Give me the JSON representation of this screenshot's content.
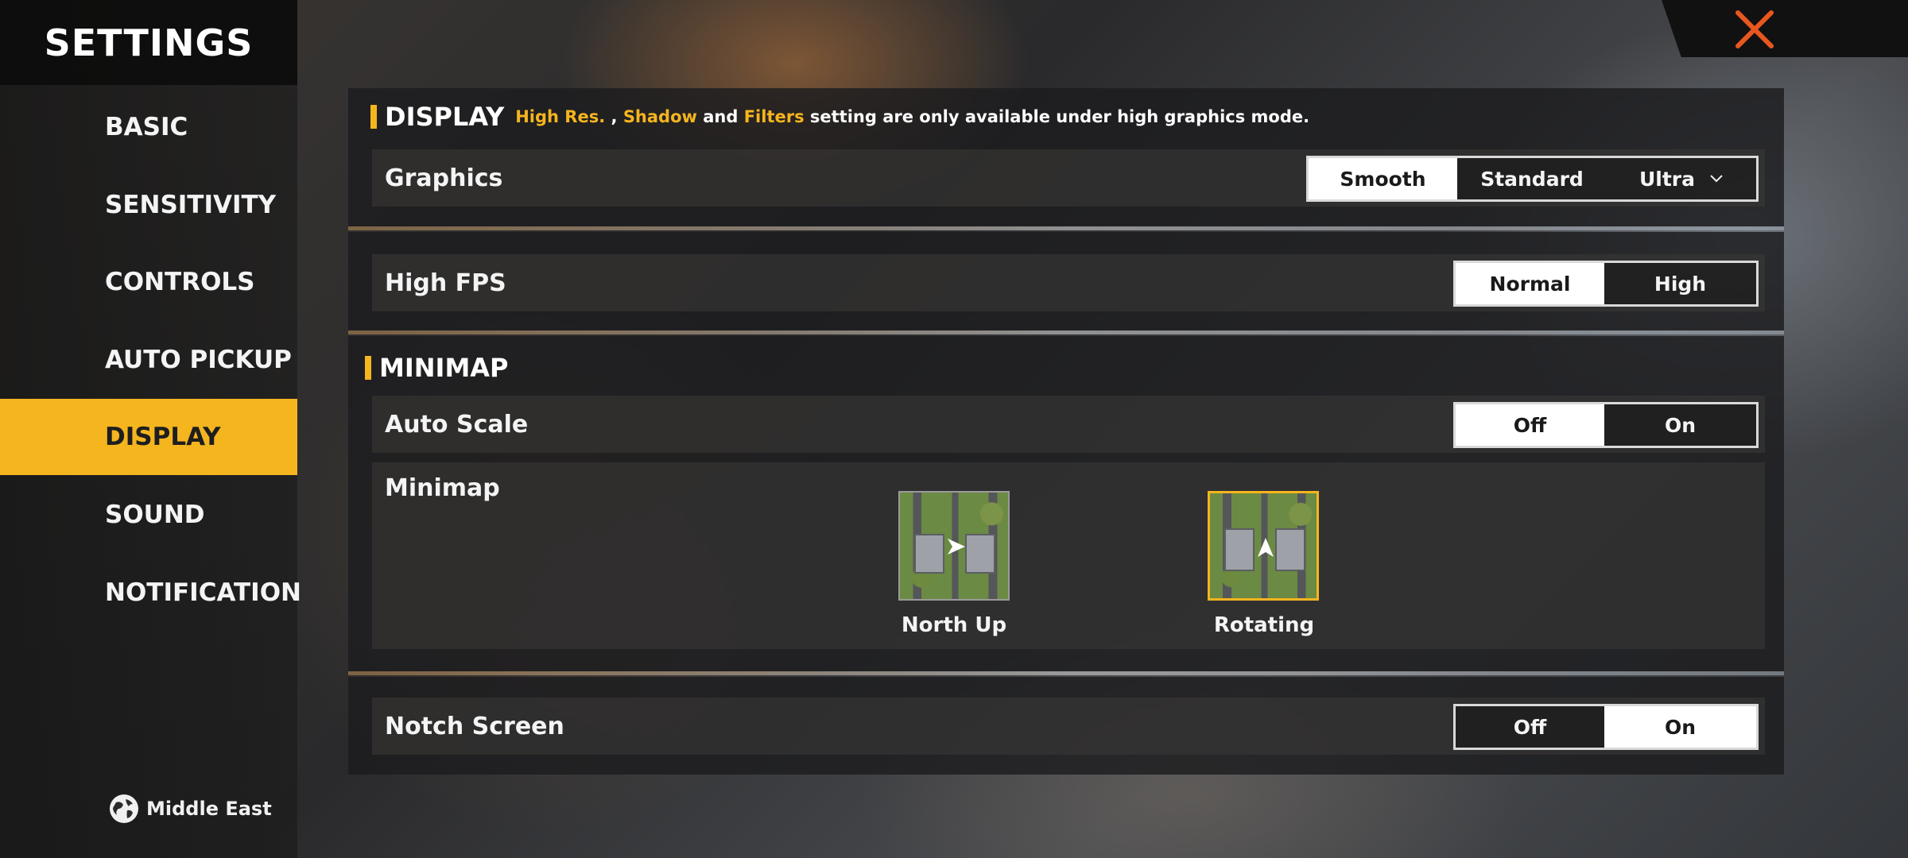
{
  "sidebar": {
    "title": "SETTINGS",
    "items": [
      {
        "label": "BASIC"
      },
      {
        "label": "SENSITIVITY"
      },
      {
        "label": "CONTROLS"
      },
      {
        "label": "AUTO PICKUP"
      },
      {
        "label": "DISPLAY"
      },
      {
        "label": "SOUND"
      },
      {
        "label": "NOTIFICATION"
      }
    ],
    "active": "DISPLAY",
    "region": {
      "icon": "globe-icon",
      "label": "Middle East"
    }
  },
  "close": {
    "icon": "close-icon",
    "color": "#e8571f"
  },
  "display": {
    "title": "DISPLAY",
    "note": {
      "part1": "High Res.",
      "part2": " , ",
      "part3": "Shadow",
      "part4": " and ",
      "part5": "Filters",
      "part6": " setting are only available under high graphics mode."
    },
    "graphics": {
      "label": "Graphics",
      "options": [
        "Smooth",
        "Standard",
        "Ultra"
      ],
      "selected": "Smooth"
    },
    "high_fps": {
      "label": "High FPS",
      "options": [
        "Normal",
        "High"
      ],
      "selected": "Normal"
    }
  },
  "minimap": {
    "title": "MINIMAP",
    "auto_scale": {
      "label": "Auto Scale",
      "options": [
        "Off",
        "On"
      ],
      "selected": "Off"
    },
    "minimap_mode": {
      "label": "Minimap",
      "options": [
        "North Up",
        "Rotating"
      ],
      "selected": "Rotating"
    }
  },
  "notch": {
    "label": "Notch Screen",
    "options": [
      "Off",
      "On"
    ],
    "selected": "On"
  },
  "colors": {
    "accent": "#f5b51f",
    "close": "#e8571f",
    "selected_bg": "#ffffff"
  }
}
